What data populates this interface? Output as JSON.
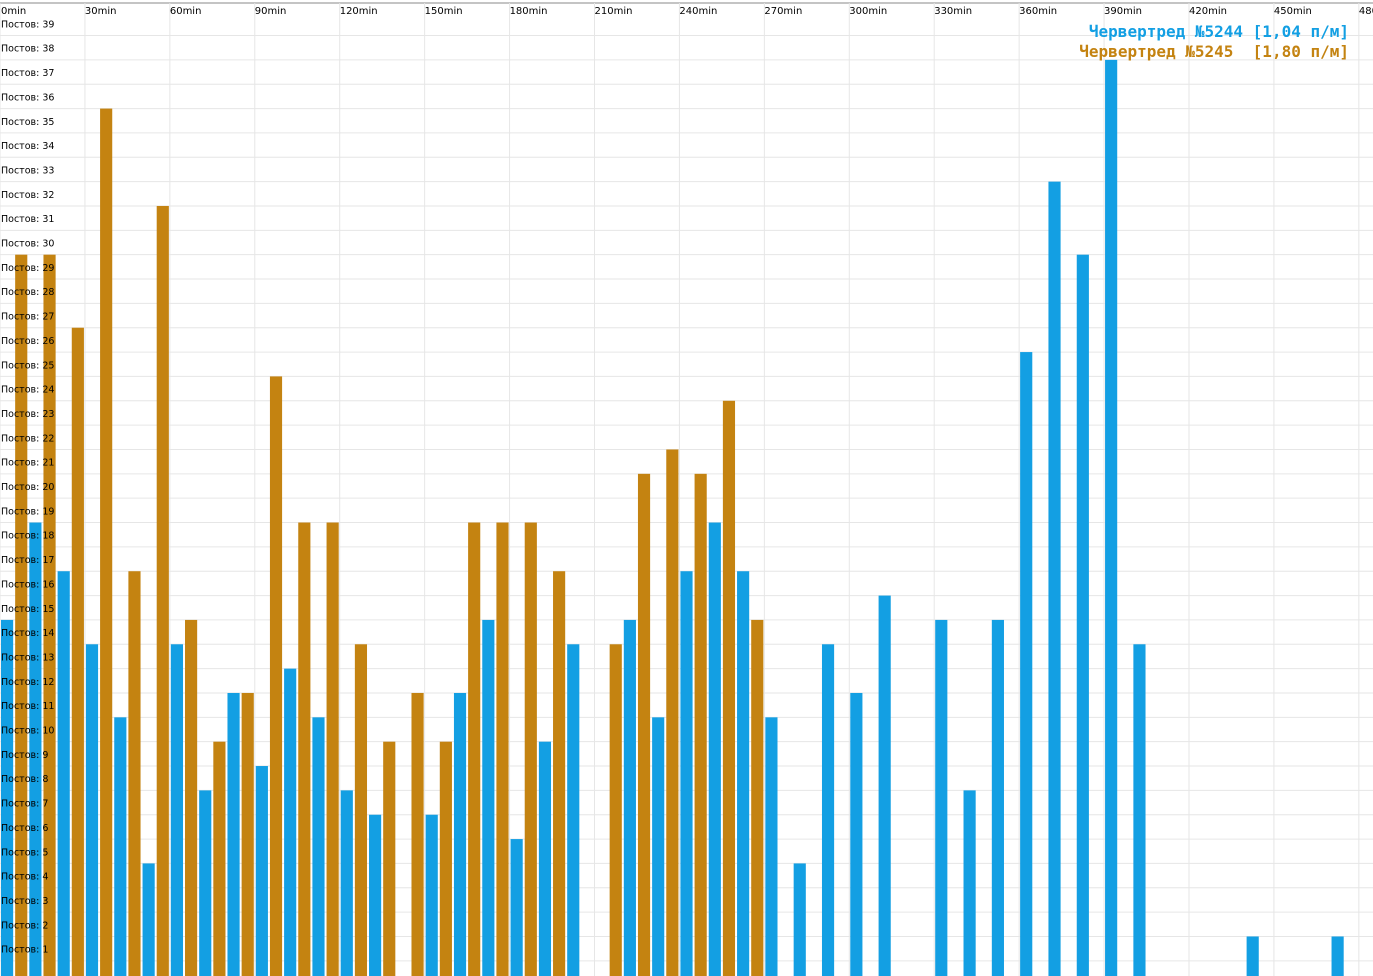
{
  "chart_data": {
    "type": "bar",
    "x_axis": {
      "tick_labels": [
        "0min",
        "30min",
        "60min",
        "90min",
        "120min",
        "150min",
        "180min",
        "210min",
        "240min",
        "270min",
        "300min",
        "330min",
        "360min",
        "390min",
        "420min",
        "450min",
        "480"
      ],
      "bin_minutes": 5,
      "range_minutes": [
        0,
        480
      ]
    },
    "y_axis": {
      "tick_prefix": "Постов:",
      "tick_values": [
        1,
        2,
        3,
        4,
        5,
        6,
        7,
        8,
        9,
        10,
        11,
        12,
        13,
        14,
        15,
        16,
        17,
        18,
        19,
        20,
        21,
        22,
        23,
        24,
        25,
        26,
        27,
        28,
        29,
        30,
        31,
        32,
        33,
        34,
        35,
        36,
        37,
        38,
        39
      ],
      "range": [
        0,
        40
      ]
    },
    "grid": true,
    "legend_position": "top-right",
    "series": [
      {
        "name": "Червертред №5244 [1,04 п/м]",
        "color": "#139fe3",
        "bars": [
          {
            "x": 0,
            "y": 14
          },
          {
            "x": 10,
            "y": 18
          },
          {
            "x": 20,
            "y": 16
          },
          {
            "x": 30,
            "y": 13
          },
          {
            "x": 40,
            "y": 10
          },
          {
            "x": 50,
            "y": 4
          },
          {
            "x": 60,
            "y": 13
          },
          {
            "x": 70,
            "y": 7
          },
          {
            "x": 80,
            "y": 11
          },
          {
            "x": 90,
            "y": 8
          },
          {
            "x": 100,
            "y": 12
          },
          {
            "x": 110,
            "y": 10
          },
          {
            "x": 120,
            "y": 7
          },
          {
            "x": 130,
            "y": 6
          },
          {
            "x": 150,
            "y": 6
          },
          {
            "x": 160,
            "y": 11
          },
          {
            "x": 170,
            "y": 14
          },
          {
            "x": 180,
            "y": 5
          },
          {
            "x": 190,
            "y": 9
          },
          {
            "x": 200,
            "y": 13
          },
          {
            "x": 220,
            "y": 14
          },
          {
            "x": 230,
            "y": 10
          },
          {
            "x": 240,
            "y": 16
          },
          {
            "x": 250,
            "y": 18
          },
          {
            "x": 260,
            "y": 16
          },
          {
            "x": 270,
            "y": 10
          },
          {
            "x": 280,
            "y": 4
          },
          {
            "x": 290,
            "y": 13
          },
          {
            "x": 300,
            "y": 11
          },
          {
            "x": 310,
            "y": 15
          },
          {
            "x": 330,
            "y": 14
          },
          {
            "x": 340,
            "y": 7
          },
          {
            "x": 350,
            "y": 14
          },
          {
            "x": 360,
            "y": 25
          },
          {
            "x": 370,
            "y": 32
          },
          {
            "x": 380,
            "y": 29
          },
          {
            "x": 390,
            "y": 37
          },
          {
            "x": 400,
            "y": 13
          },
          {
            "x": 440,
            "y": 1
          },
          {
            "x": 470,
            "y": 1
          }
        ]
      },
      {
        "name": "Червертред №5245  [1,80 п/м]",
        "color": "#c48311",
        "bars": [
          {
            "x": 5,
            "y": 29
          },
          {
            "x": 15,
            "y": 29
          },
          {
            "x": 25,
            "y": 26
          },
          {
            "x": 35,
            "y": 35
          },
          {
            "x": 45,
            "y": 16
          },
          {
            "x": 55,
            "y": 31
          },
          {
            "x": 65,
            "y": 14
          },
          {
            "x": 75,
            "y": 9
          },
          {
            "x": 85,
            "y": 11
          },
          {
            "x": 95,
            "y": 24
          },
          {
            "x": 105,
            "y": 18
          },
          {
            "x": 115,
            "y": 18
          },
          {
            "x": 125,
            "y": 13
          },
          {
            "x": 135,
            "y": 9
          },
          {
            "x": 145,
            "y": 11
          },
          {
            "x": 155,
            "y": 9
          },
          {
            "x": 165,
            "y": 18
          },
          {
            "x": 175,
            "y": 18
          },
          {
            "x": 185,
            "y": 18
          },
          {
            "x": 195,
            "y": 16
          },
          {
            "x": 215,
            "y": 13
          },
          {
            "x": 225,
            "y": 20
          },
          {
            "x": 235,
            "y": 21
          },
          {
            "x": 245,
            "y": 20
          },
          {
            "x": 255,
            "y": 23
          },
          {
            "x": 265,
            "y": 14
          }
        ]
      }
    ]
  }
}
